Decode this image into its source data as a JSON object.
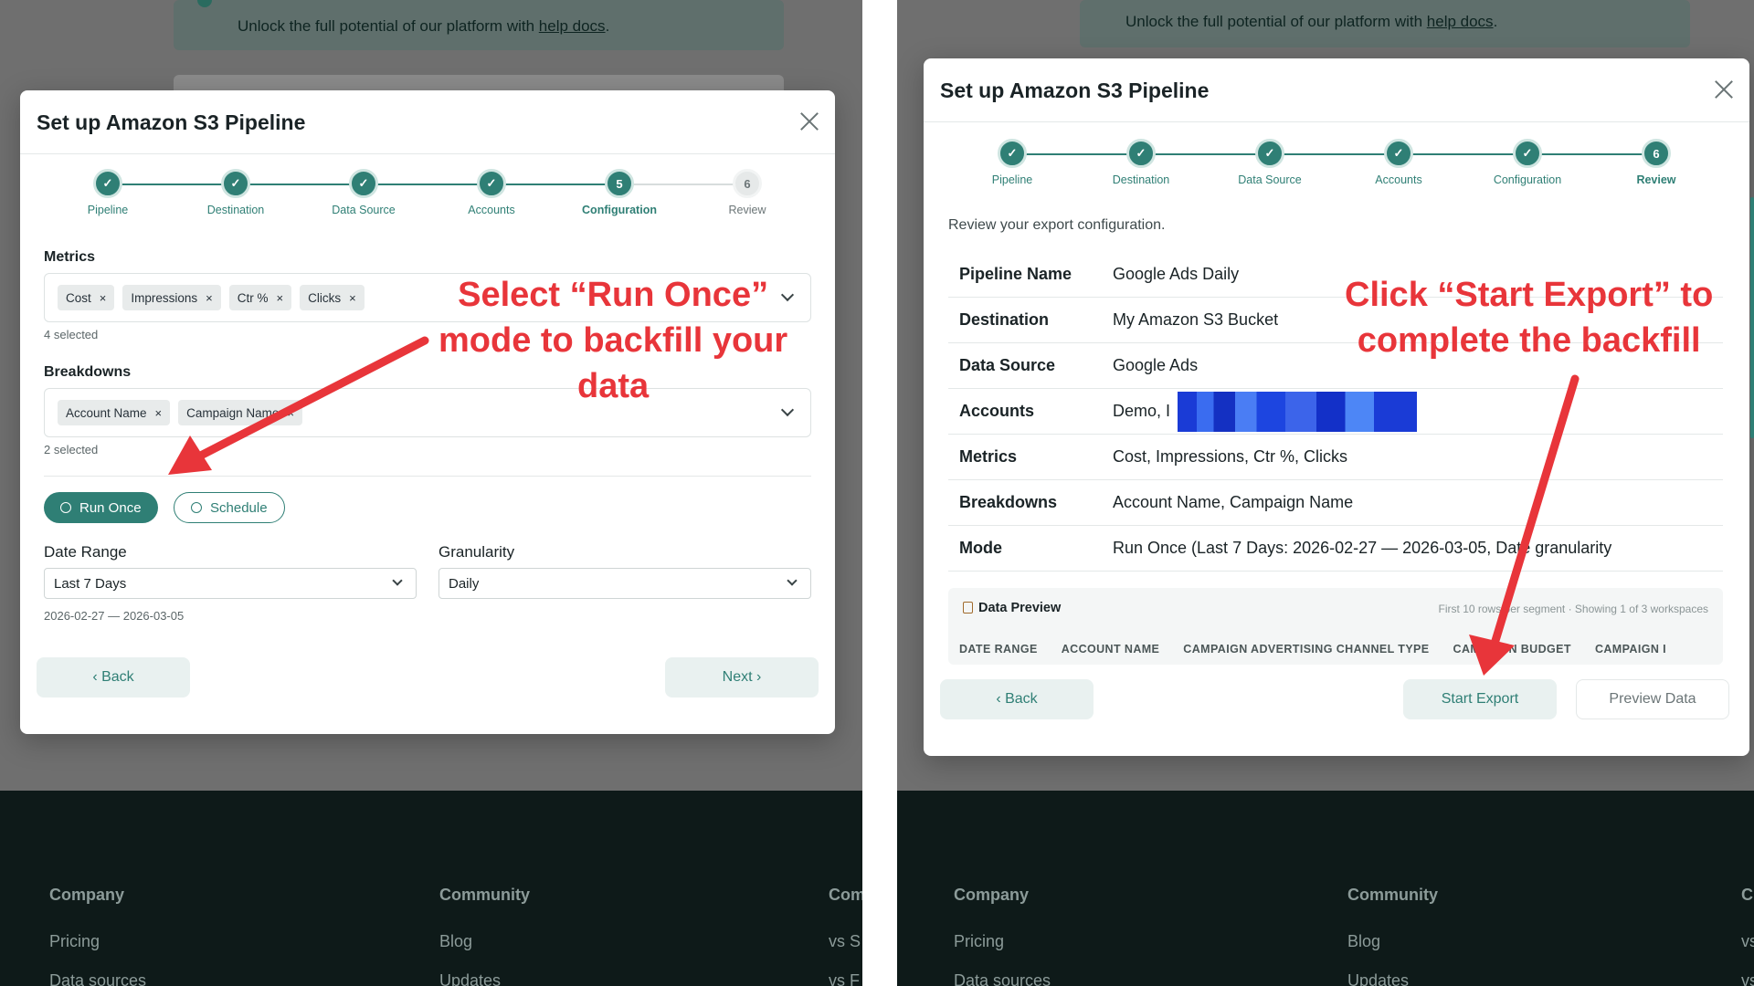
{
  "help_banner": {
    "text": "Unlock the full potential of our platform with ",
    "link": "help docs",
    "period": "."
  },
  "footer": {
    "columns": [
      {
        "head": "Company",
        "items": [
          "Pricing",
          "Data sources"
        ]
      },
      {
        "head": "Community",
        "items": [
          "Blog",
          "Updates"
        ]
      },
      {
        "head": "Com",
        "items": [
          "vs S",
          "vs F"
        ]
      }
    ],
    "right_columns": [
      {
        "head": "Company",
        "items": [
          "Pricing",
          "Data sources"
        ]
      },
      {
        "head": "Community",
        "items": [
          "Blog",
          "Updates"
        ]
      },
      {
        "head": "C",
        "items": [
          "vs",
          "vs"
        ]
      }
    ]
  },
  "modal": {
    "title": "Set up Amazon S3 Pipeline"
  },
  "stepper": {
    "steps": [
      "Pipeline",
      "Destination",
      "Data Source",
      "Accounts",
      "Configuration",
      "Review"
    ],
    "done_mark": "✓",
    "left_current": "5",
    "left_next": "6",
    "right_current": "6"
  },
  "config": {
    "metrics_label": "Metrics",
    "metrics": [
      "Cost",
      "Impressions",
      "Ctr %",
      "Clicks"
    ],
    "metrics_count": "4 selected",
    "breakdowns_label": "Breakdowns",
    "breakdowns": [
      "Account Name",
      "Campaign Name"
    ],
    "breakdowns_count": "2 selected",
    "chip_remove": "×",
    "run_once": "Run Once",
    "schedule": "Schedule",
    "date_range_label": "Date Range",
    "date_range_value": "Last 7 Days",
    "date_note": "2026-02-27 — 2026-03-05",
    "granularity_label": "Granularity",
    "granularity_value": "Daily",
    "back": "‹  Back",
    "next": "Next  ›"
  },
  "review": {
    "intro": "Review your export configuration.",
    "rows": [
      {
        "key": "Pipeline Name",
        "value": "Google Ads Daily"
      },
      {
        "key": "Destination",
        "value": "My Amazon S3 Bucket"
      },
      {
        "key": "Data Source",
        "value": "Google Ads"
      },
      {
        "key": "Accounts",
        "value": "Demo, I"
      },
      {
        "key": "Metrics",
        "value": "Cost, Impressions, Ctr %, Clicks"
      },
      {
        "key": "Breakdowns",
        "value": "Account Name, Campaign Name"
      },
      {
        "key": "Mode",
        "value": "Run Once (Last 7 Days: 2026-02-27 — 2026-03-05, Date granularity"
      }
    ],
    "preview_title": "Data Preview",
    "preview_note": "First 10 rows per segment · Showing 1 of 3 workspaces",
    "preview_columns": [
      "DATE RANGE",
      "ACCOUNT NAME",
      "CAMPAIGN ADVERTISING CHANNEL TYPE",
      "CAMPAIGN BUDGET",
      "CAMPAIGN I"
    ],
    "back": "‹  Back",
    "start_export": "Start Export",
    "preview_data": "Preview Data"
  },
  "annotations": {
    "left": [
      "Select “Run Once”",
      "mode to backfill your",
      "data"
    ],
    "right": [
      "Click “Start Export” to",
      "complete the backfill"
    ],
    "color": "#e8353a"
  },
  "colors": {
    "accent": "#2f7f75",
    "footer_bg": "#0e1a19",
    "overlay": "#6f6f6f"
  }
}
